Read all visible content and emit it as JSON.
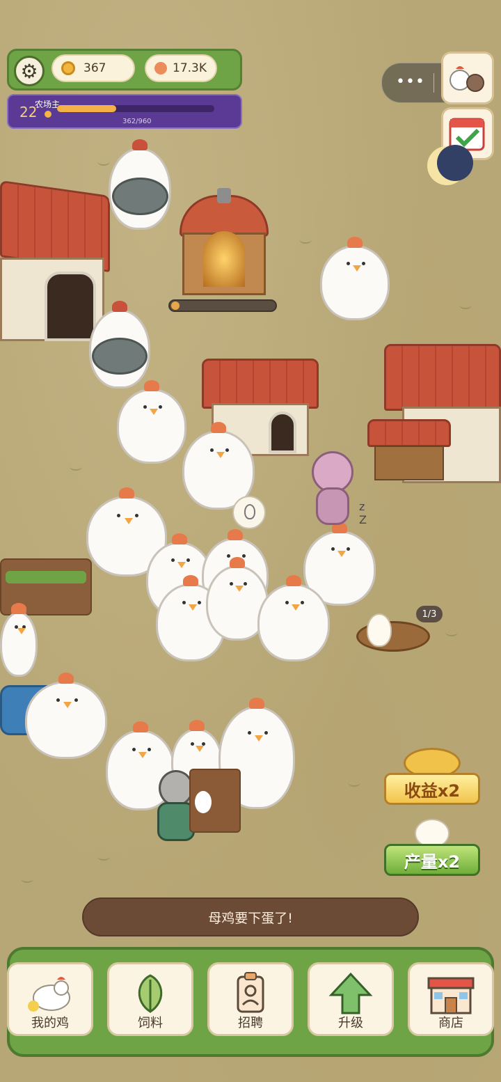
{
  "hud": {
    "coins": "367",
    "gems": "17.3K",
    "level": "22",
    "level_title": "农场主",
    "xp_text": "362/960",
    "xp_progress": 0.377
  },
  "nest": {
    "counter": "1/3"
  },
  "banner": {
    "text": "母鸡要下蛋了!"
  },
  "bonuses": {
    "income": "收益x2",
    "output": "产量x2"
  },
  "nav": {
    "items": [
      {
        "label": "我的鸡",
        "icon": "chicken-icon"
      },
      {
        "label": "饲料",
        "icon": "leaf-icon"
      },
      {
        "label": "招聘",
        "icon": "badge-icon"
      },
      {
        "label": "升级",
        "icon": "arrow-up-icon"
      },
      {
        "label": "商店",
        "icon": "shop-icon"
      }
    ]
  },
  "colors": {
    "hud_green": "#6fa446",
    "level_purple": "#5a3a95",
    "banner_brown": "#6b4a36",
    "gold": "#f2c44c"
  }
}
